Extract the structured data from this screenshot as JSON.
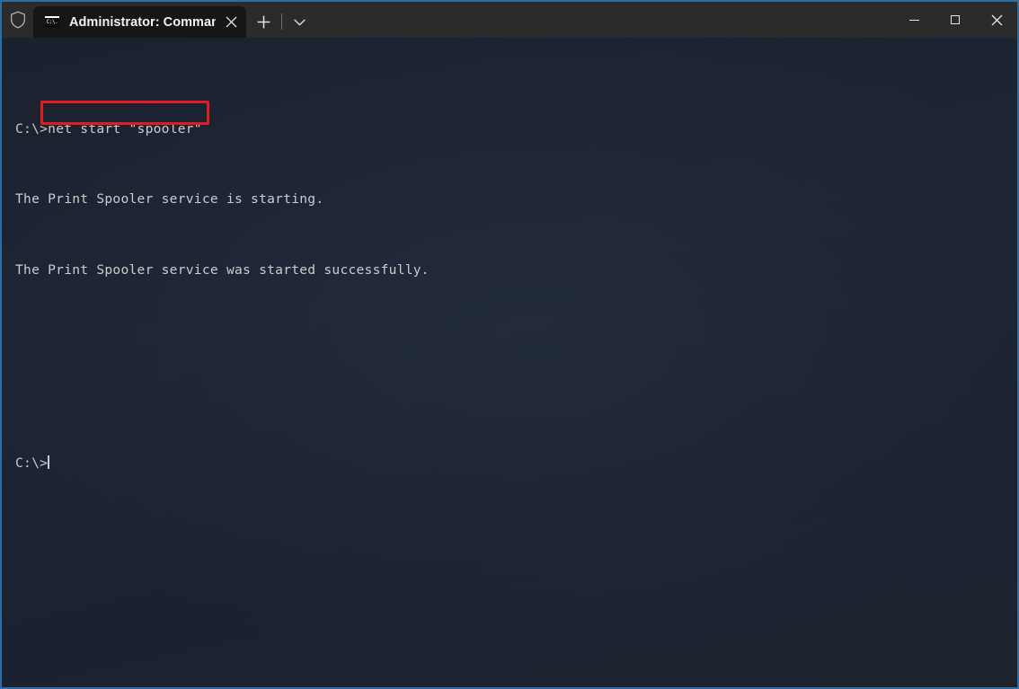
{
  "window": {
    "accent_color": "#2e6ca4",
    "titlebar_bg": "#2b2b2b",
    "terminal_bg": "#1c2333",
    "text_color": "#cccccc"
  },
  "titlebar": {
    "shield_icon": "shield-icon",
    "tab": {
      "icon": "cmd-console-icon",
      "title": "Administrator: Command Pror",
      "close_label": "✕"
    },
    "new_tab_label": "+",
    "dropdown_label": "⌄",
    "controls": {
      "minimize_label": "—",
      "maximize_label": "□",
      "close_label": "✕"
    }
  },
  "terminal": {
    "lines": [
      {
        "prompt": "C:\\>",
        "text": "net start \"spooler\"",
        "highlight": true
      },
      {
        "prompt": "",
        "text": "The Print Spooler service is starting.",
        "highlight": false
      },
      {
        "prompt": "",
        "text": "The Print Spooler service was started successfully.",
        "highlight": false
      },
      {
        "prompt": "",
        "text": "",
        "highlight": false
      },
      {
        "prompt": "",
        "text": "",
        "highlight": false
      },
      {
        "prompt": "C:\\>",
        "text": "",
        "highlight": false,
        "cursor": true
      }
    ],
    "annotation": {
      "color": "#e11b22",
      "target_text": "net start \"spooler\""
    }
  }
}
